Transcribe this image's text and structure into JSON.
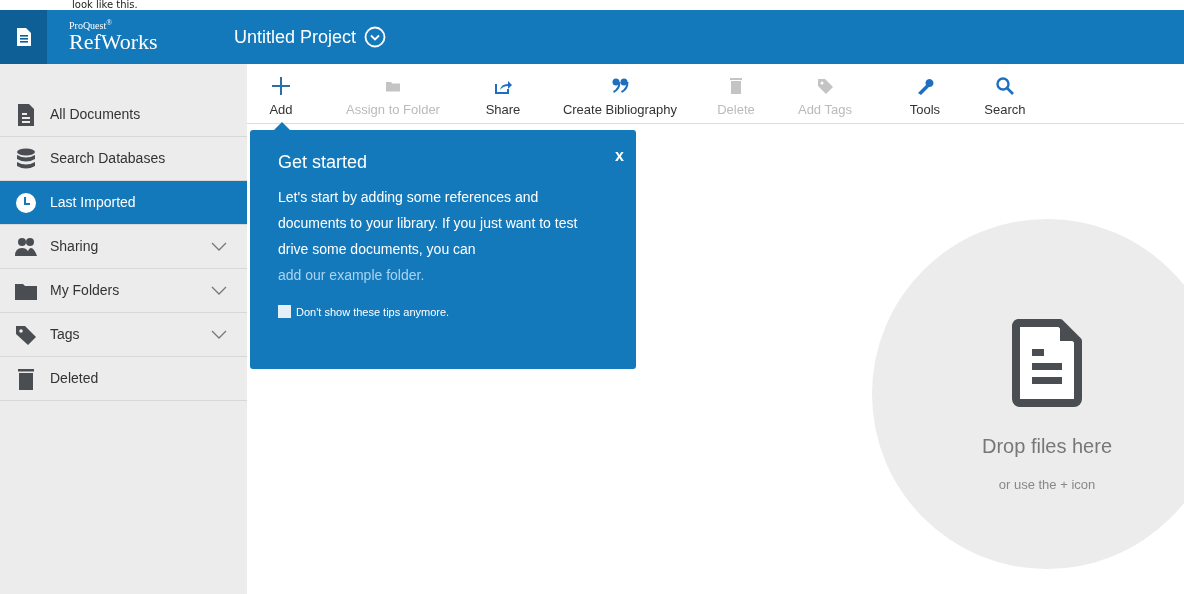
{
  "caption": "look like this.",
  "header": {
    "brand_small": "ProQuest",
    "brand_mark": "®",
    "brand": "RefWorks",
    "project": "Untitled Project"
  },
  "sidebar": {
    "items": [
      {
        "label": "All Documents",
        "selected": false,
        "expandable": false
      },
      {
        "label": "Search Databases",
        "selected": false,
        "expandable": false
      },
      {
        "label": "Last Imported",
        "selected": true,
        "expandable": false
      },
      {
        "label": "Sharing",
        "selected": false,
        "expandable": true
      },
      {
        "label": "My Folders",
        "selected": false,
        "expandable": true
      },
      {
        "label": "Tags",
        "selected": false,
        "expandable": true
      },
      {
        "label": "Deleted",
        "selected": false,
        "expandable": false
      }
    ]
  },
  "toolbar": [
    {
      "label": "Add",
      "disabled": false
    },
    {
      "label": "Assign to Folder",
      "disabled": true
    },
    {
      "label": "Share",
      "disabled": false
    },
    {
      "label": "Create Bibliography",
      "disabled": false
    },
    {
      "label": "Delete",
      "disabled": true
    },
    {
      "label": "Add Tags",
      "disabled": true
    },
    {
      "label": "Tools",
      "disabled": false
    },
    {
      "label": "Search",
      "disabled": false
    }
  ],
  "tip": {
    "title": "Get started",
    "close": "x",
    "text": "Let's start by adding some references and documents to your library. If you just want to test drive some documents, you can",
    "link": "add our example folder.",
    "checkbox": {
      "label": "Don't show these tips anymore.",
      "checked": false
    }
  },
  "dropzone": {
    "title": "Drop files here",
    "subtitle": "or use the + icon"
  }
}
